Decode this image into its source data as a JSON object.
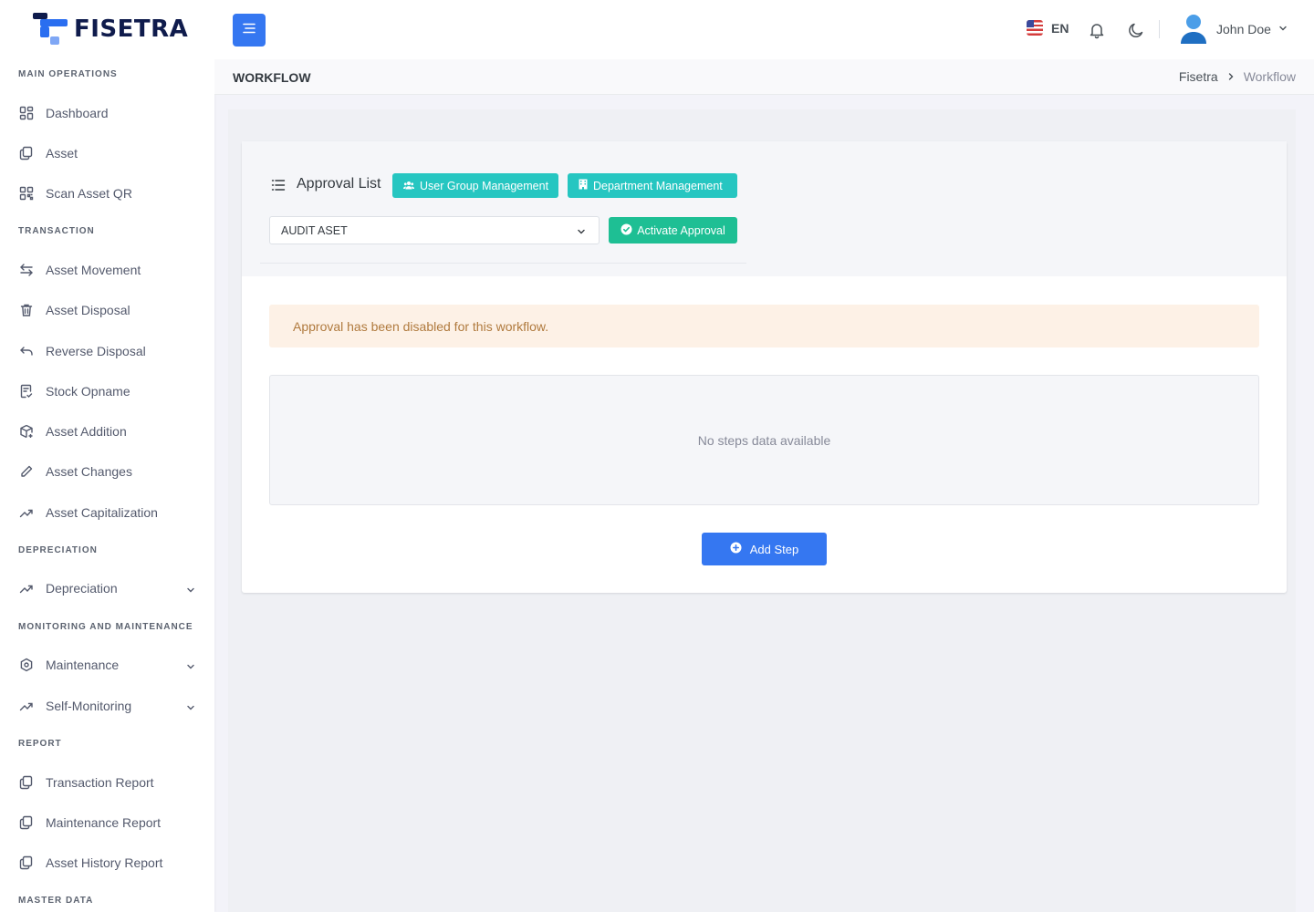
{
  "app": {
    "brand": "FISETRA"
  },
  "sidebar": {
    "sections": [
      {
        "title": "MAIN OPERATIONS"
      },
      {
        "title": "TRANSACTION"
      },
      {
        "title": "DEPRECIATION"
      },
      {
        "title": "MONITORING AND MAINTENANCE"
      },
      {
        "title": "REPORT"
      },
      {
        "title": "MASTER DATA"
      }
    ],
    "items": [
      {
        "label": "Dashboard",
        "icon": "dashboard-icon"
      },
      {
        "label": "Asset",
        "icon": "copy-icon"
      },
      {
        "label": "Scan Asset QR",
        "icon": "qr-icon"
      },
      {
        "label": "Asset Movement",
        "icon": "swap-icon"
      },
      {
        "label": "Asset Disposal",
        "icon": "trash-icon"
      },
      {
        "label": "Reverse Disposal",
        "icon": "reply-icon"
      },
      {
        "label": "Stock Opname",
        "icon": "checklist-icon"
      },
      {
        "label": "Asset Addition",
        "icon": "box-add-icon"
      },
      {
        "label": "Asset Changes",
        "icon": "pencil-icon"
      },
      {
        "label": "Asset Capitalization",
        "icon": "trending-up-icon"
      },
      {
        "label": "Depreciation",
        "icon": "trending-up-icon",
        "expandable": true
      },
      {
        "label": "Maintenance",
        "icon": "hexagon-settings-icon",
        "expandable": true
      },
      {
        "label": "Self-Monitoring",
        "icon": "trending-up-icon",
        "expandable": true
      },
      {
        "label": "Transaction Report",
        "icon": "copy-icon"
      },
      {
        "label": "Maintenance Report",
        "icon": "copy-icon"
      },
      {
        "label": "Asset History Report",
        "icon": "copy-icon"
      }
    ]
  },
  "topbar": {
    "language": "EN",
    "user_name": "John Doe"
  },
  "page": {
    "title": "WORKFLOW",
    "breadcrumb": [
      "Fisetra",
      "Workflow"
    ]
  },
  "card": {
    "title": "Approval List",
    "user_group_button": "User Group Management",
    "department_button": "Department Management",
    "select_value": "AUDIT ASET",
    "activate_button": "Activate Approval",
    "alert": "Approval has been disabled for this workflow.",
    "empty_text": "No steps data available",
    "add_step_button": "Add Step"
  },
  "colors": {
    "primary": "#3577f1",
    "teal": "#26c6c1",
    "success": "#1ebf94",
    "warning_bg": "#fdf1e6",
    "warning_text": "#b07a3e",
    "brand_dark": "#0f1b4c"
  }
}
